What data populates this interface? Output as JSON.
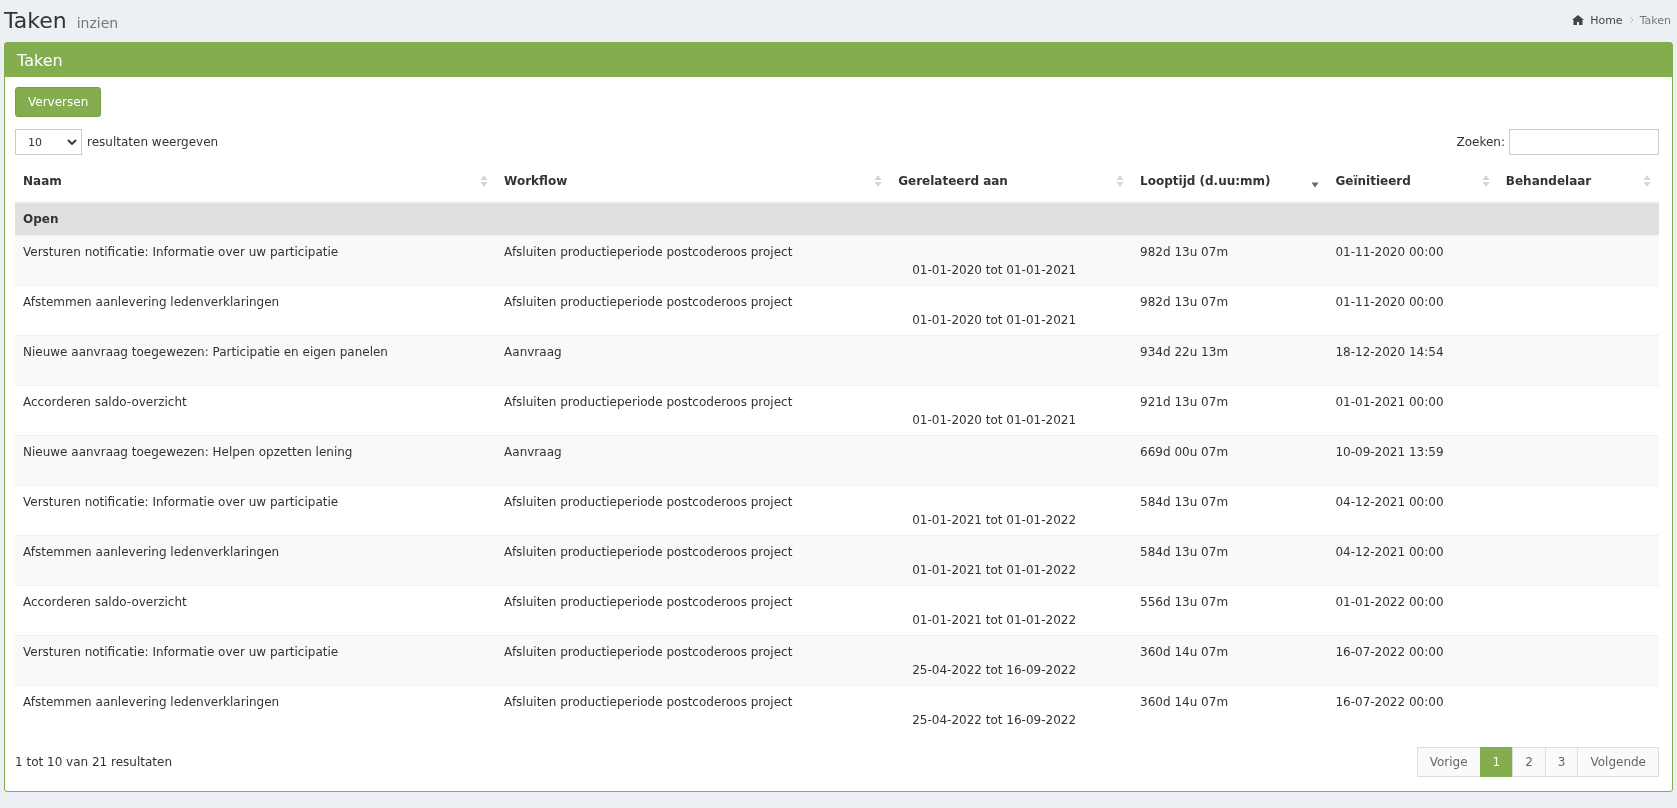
{
  "page": {
    "title": "Taken",
    "subtitle": "inzien"
  },
  "breadcrumb": [
    "Home",
    "Taken"
  ],
  "panel": {
    "title": "Taken",
    "refresh_button": "Verversen"
  },
  "length": {
    "value": "10",
    "label": "resultaten weergeven"
  },
  "search": {
    "label": "Zoeken:"
  },
  "table": {
    "columns": [
      {
        "label": "Naam",
        "sorted_desc": false
      },
      {
        "label": "Workflow",
        "sorted_desc": false
      },
      {
        "label": "Gerelateerd aan",
        "sorted_desc": false
      },
      {
        "label": "Looptijd (d.uu:mm)",
        "sorted_desc": true
      },
      {
        "label": "Geïnitieerd",
        "sorted_desc": false
      },
      {
        "label": "Behandelaar",
        "sorted_desc": false
      }
    ],
    "group": "Open",
    "rows": [
      {
        "name": "Versturen notificatie: Informatie over uw participatie",
        "workflow": "Afsluiten productieperiode postcoderoos project",
        "related": "01-01-2020 tot 01-01-2021",
        "duration": "982d 13u 07m",
        "initiated": "01-11-2020 00:00"
      },
      {
        "name": "Afstemmen aanlevering ledenverklaringen",
        "workflow": "Afsluiten productieperiode postcoderoos project",
        "related": "01-01-2020 tot 01-01-2021",
        "duration": "982d 13u 07m",
        "initiated": "01-11-2020 00:00"
      },
      {
        "name": "Nieuwe aanvraag toegewezen: Participatie en eigen panelen",
        "workflow": "Aanvraag",
        "duration": "934d 22u 13m",
        "initiated": "18-12-2020 14:54"
      },
      {
        "name": "Accorderen saldo-overzicht",
        "workflow": "Afsluiten productieperiode postcoderoos project",
        "related": "01-01-2020 tot 01-01-2021",
        "duration": "921d 13u 07m",
        "initiated": "01-01-2021 00:00"
      },
      {
        "name": "Nieuwe aanvraag toegewezen: Helpen opzetten lening",
        "workflow": "Aanvraag",
        "duration": "669d 00u 07m",
        "initiated": "10-09-2021 13:59"
      },
      {
        "name": "Versturen notificatie: Informatie over uw participatie",
        "workflow": "Afsluiten productieperiode postcoderoos project",
        "related": "01-01-2021 tot 01-01-2022",
        "duration": "584d 13u 07m",
        "initiated": "04-12-2021 00:00"
      },
      {
        "name": "Afstemmen aanlevering ledenverklaringen",
        "workflow": "Afsluiten productieperiode postcoderoos project",
        "related": "01-01-2021 tot 01-01-2022",
        "duration": "584d 13u 07m",
        "initiated": "04-12-2021 00:00"
      },
      {
        "name": "Accorderen saldo-overzicht",
        "workflow": "Afsluiten productieperiode postcoderoos project",
        "related": "01-01-2021 tot 01-01-2022",
        "duration": "556d 13u 07m",
        "initiated": "01-01-2022 00:00"
      },
      {
        "name": "Versturen notificatie: Informatie over uw participatie",
        "workflow": "Afsluiten productieperiode postcoderoos project",
        "related": "25-04-2022 tot 16-09-2022",
        "duration": "360d 14u 07m",
        "initiated": "16-07-2022 00:00"
      },
      {
        "name": "Afstemmen aanlevering ledenverklaringen",
        "workflow": "Afsluiten productieperiode postcoderoos project",
        "related": "25-04-2022 tot 16-09-2022",
        "duration": "360d 14u 07m",
        "initiated": "16-07-2022 00:00"
      }
    ]
  },
  "info": "1 tot 10 van 21 resultaten",
  "pagination": {
    "previous": "Vorige",
    "pages": [
      {
        "label": "1",
        "selected": true
      },
      {
        "label": "2",
        "selected": false
      },
      {
        "label": "3",
        "selected": false
      }
    ],
    "next": "Volgende"
  }
}
